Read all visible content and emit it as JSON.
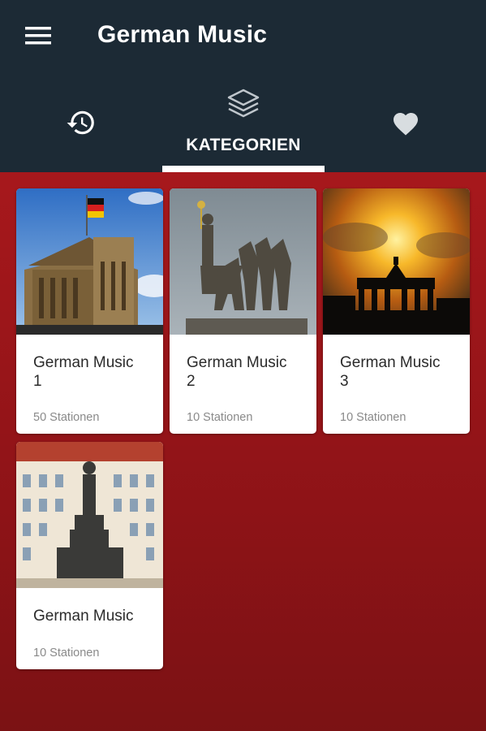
{
  "app": {
    "title": "German Music"
  },
  "tabs": [
    {
      "icon": "history-icon",
      "label": ""
    },
    {
      "icon": "layers-icon",
      "label": "KATEGORIEN",
      "selected": true
    },
    {
      "icon": "heart-icon",
      "label": ""
    }
  ],
  "categories": [
    {
      "title": "German Music\n1",
      "subtitle": "50 Stationen",
      "image": "reichstag-flag-image"
    },
    {
      "title": "German Music\n2",
      "subtitle": "10 Stationen",
      "image": "quadriga-statue-image"
    },
    {
      "title": "German Music\n3",
      "subtitle": "10 Stationen",
      "image": "brandenburg-gate-sunset-image"
    },
    {
      "title": "German Music",
      "subtitle": "10 Stationen",
      "image": "dresden-monument-image"
    }
  ],
  "colors": {
    "appbar": "#1c2a35",
    "content_bg": "#9a1519",
    "card_bg": "#ffffff",
    "tab_indicator": "#ffffff"
  }
}
